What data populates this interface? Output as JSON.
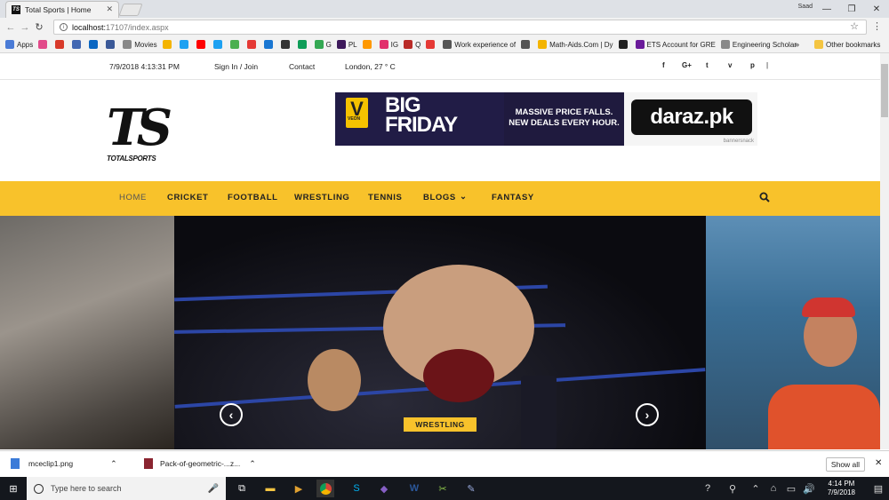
{
  "browser": {
    "tab_title": "Total Sports | Home",
    "user": "Saad",
    "url_host": "localhost:",
    "url_path": "17107/index.aspx"
  },
  "bookmarks": [
    {
      "label": "Apps",
      "color": "#4a7bd6"
    },
    {
      "label": "",
      "color": "#e24a8a"
    },
    {
      "label": "",
      "color": "#d83a2a"
    },
    {
      "label": "",
      "color": "#4267b2"
    },
    {
      "label": "",
      "color": "#0a66c2"
    },
    {
      "label": "",
      "color": "#3b5998"
    },
    {
      "label": "Movies",
      "color": "#888888"
    },
    {
      "label": "",
      "color": "#f4b400"
    },
    {
      "label": "",
      "color": "#1da1f2"
    },
    {
      "label": "",
      "color": "#ff0000"
    },
    {
      "label": "",
      "color": "#1da1f2"
    },
    {
      "label": "",
      "color": "#4caf50"
    },
    {
      "label": "",
      "color": "#e53935"
    },
    {
      "label": "",
      "color": "#1976d2"
    },
    {
      "label": "",
      "color": "#333333"
    },
    {
      "label": "",
      "color": "#0f9d58"
    },
    {
      "label": "G",
      "color": "#34a853"
    },
    {
      "label": "PL",
      "color": "#3d195b"
    },
    {
      "label": "",
      "color": "#ff9800"
    },
    {
      "label": "IG",
      "color": "#e1306c"
    },
    {
      "label": "Q",
      "color": "#b92b27"
    },
    {
      "label": "",
      "color": "#e53935"
    },
    {
      "label": "Work experience of",
      "color": "#555555"
    },
    {
      "label": "",
      "color": "#555555"
    },
    {
      "label": "Math-Aids.Com | Dy",
      "color": "#f4b400"
    },
    {
      "label": "",
      "color": "#222222"
    },
    {
      "label": "ETS Account for GRE",
      "color": "#6a1b9a"
    },
    {
      "label": "Engineering Scholar",
      "color": "#888888"
    }
  ],
  "bookmarks_more": "»",
  "other_bookmarks": "Other bookmarks",
  "topbar": {
    "datetime": "7/9/2018 4:13:31 PM",
    "signin": "Sign In / Join",
    "contact": "Contact",
    "weather": "London, 27 ° C",
    "social": [
      "f",
      "G+",
      "t",
      "v",
      "p"
    ]
  },
  "logo": {
    "mark": "TS",
    "text": "TOTALSPORTS"
  },
  "banner": {
    "v": "V",
    "veon": "VEON",
    "big1": "BIG",
    "big2": "FRIDAY",
    "line1": "MASSIVE PRICE FALLS.",
    "line2": "NEW DEALS EVERY HOUR.",
    "brand": "daraz.pk",
    "credit": "bannersnack"
  },
  "nav": [
    "HOME",
    "CRICKET",
    "FOOTBALL",
    "WRESTLING",
    "TENNIS",
    "BLOGS",
    "FANTASY"
  ],
  "slider": {
    "category": "WRESTLING",
    "prev": "‹",
    "next": "›"
  },
  "downloads": [
    {
      "name": "mceclip1.png"
    },
    {
      "name": "Pack-of-geometric-...z..."
    }
  ],
  "show_all": "Show all",
  "taskbar": {
    "search": "Type here to search",
    "time": "4:14 PM",
    "date": "7/9/2018"
  },
  "colors": {
    "accent": "#f8c22b",
    "nav_active": "#555555"
  }
}
